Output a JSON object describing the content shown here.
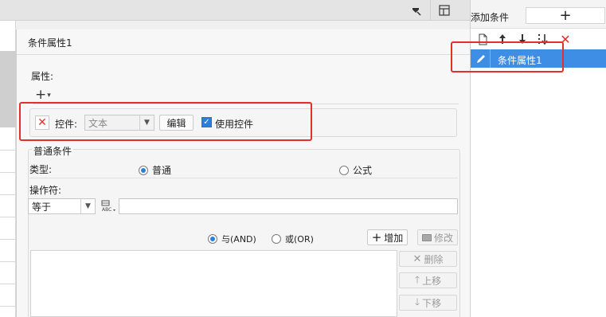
{
  "topbar": {
    "icons": [
      "dropdown-arrow-icon",
      "layout-icon"
    ]
  },
  "dialog": {
    "title": "条件属性1",
    "property_section_label": "属性:",
    "add_symbol": "+",
    "add_caret": "▾",
    "control_row": {
      "remove_glyph": "✕",
      "control_label": "控件:",
      "control_select_value": "文本",
      "edit_button": "编辑",
      "use_control_checked": true,
      "use_control_label": "使用控件"
    },
    "normal_condition": {
      "section_label": "普通条件",
      "type_label": "类型:",
      "type_options": [
        {
          "label": "普通",
          "checked": true
        },
        {
          "label": "公式",
          "checked": false
        }
      ],
      "operator_label": "操作符:",
      "operator_value": "等于",
      "value_input": "",
      "logic_options": [
        {
          "label": "与(AND)",
          "checked": true
        },
        {
          "label": "或(OR)",
          "checked": false
        }
      ],
      "add_button": "增加",
      "modify_button": "修改",
      "delete_button": "删除",
      "move_up_button": "上移",
      "move_down_button": "下移"
    }
  },
  "right_panel": {
    "add_condition_label": "添加条件",
    "add_condition_button": "+",
    "toolbar_icons": [
      "copy-icon",
      "arrow-up-icon",
      "arrow-down-icon",
      "sort-icon",
      "delete-icon"
    ],
    "items": [
      {
        "label": "条件属性1",
        "selected": true
      }
    ]
  },
  "colors": {
    "highlight_red": "#e5302a",
    "selection_blue": "#3f8ee6",
    "radio_blue": "#2b7fd9"
  }
}
